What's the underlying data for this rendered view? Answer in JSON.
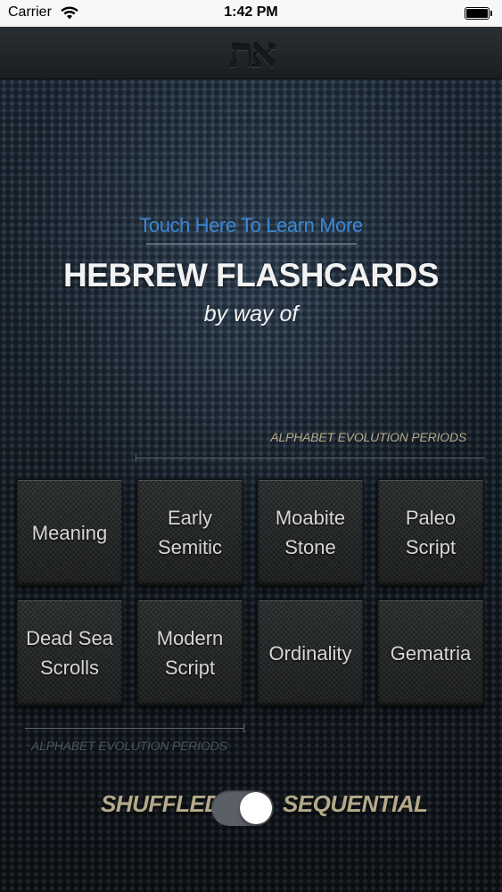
{
  "status_bar": {
    "carrier": "Carrier",
    "time": "1:42 PM",
    "wifi_icon": "wifi-icon",
    "battery_icon": "battery-icon"
  },
  "header": {
    "logo": "את"
  },
  "intro": {
    "learn_more": "Touch Here To Learn More",
    "title": "HEBREW FLASHCARDS",
    "subtitle": "by way of"
  },
  "periods": {
    "top_label": "ALPHABET EVOLUTION PERIODS",
    "bottom_label": "ALPHABET EVOLUTION PERIODS"
  },
  "tiles": [
    {
      "line1": "Meaning",
      "line2": ""
    },
    {
      "line1": "Early",
      "line2": "Semitic"
    },
    {
      "line1": "Moabite",
      "line2": "Stone"
    },
    {
      "line1": "Paleo",
      "line2": "Script"
    },
    {
      "line1": "Dead Sea",
      "line2": "Scrolls"
    },
    {
      "line1": "Modern",
      "line2": "Script"
    },
    {
      "line1": "Ordinality",
      "line2": ""
    },
    {
      "line1": "Gematria",
      "line2": ""
    }
  ],
  "mode": {
    "left_label": "SHUFFLED",
    "right_label": "SEQUENTIAL",
    "selected": "SEQUENTIAL"
  },
  "colors": {
    "link": "#3b86d6",
    "accent_text": "#b4a98a",
    "title_text": "#f2f2f2"
  }
}
